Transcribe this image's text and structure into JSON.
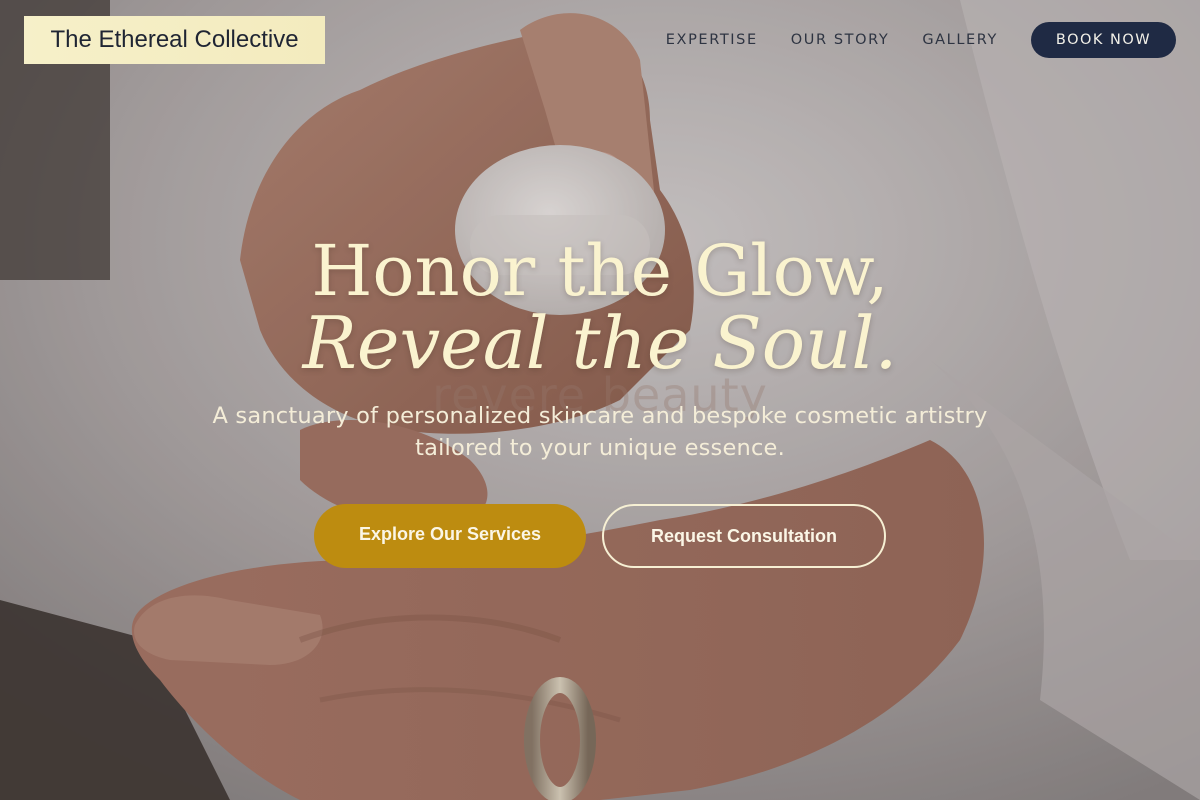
{
  "header": {
    "logo_text": "The Ethereal Collective",
    "nav": [
      {
        "label": "EXPERTISE"
      },
      {
        "label": "OUR STORY"
      },
      {
        "label": "GALLERY"
      }
    ],
    "cta_label": "BOOK NOW"
  },
  "hero": {
    "headline_line1": "Honor the Glow,",
    "headline_line2": "Reveal the Soul.",
    "background_word": "revere beauty",
    "subtitle": "A sanctuary of personalized skincare and bespoke cosmetic artistry tailored to your unique essence.",
    "primary_button": "Explore Our Services",
    "secondary_button": "Request Consultation"
  },
  "colors": {
    "accent_gold": "#bd8c10",
    "navy": "#1f2a44",
    "cream": "#faf3cf",
    "logo_bg": "#f5eec6"
  }
}
